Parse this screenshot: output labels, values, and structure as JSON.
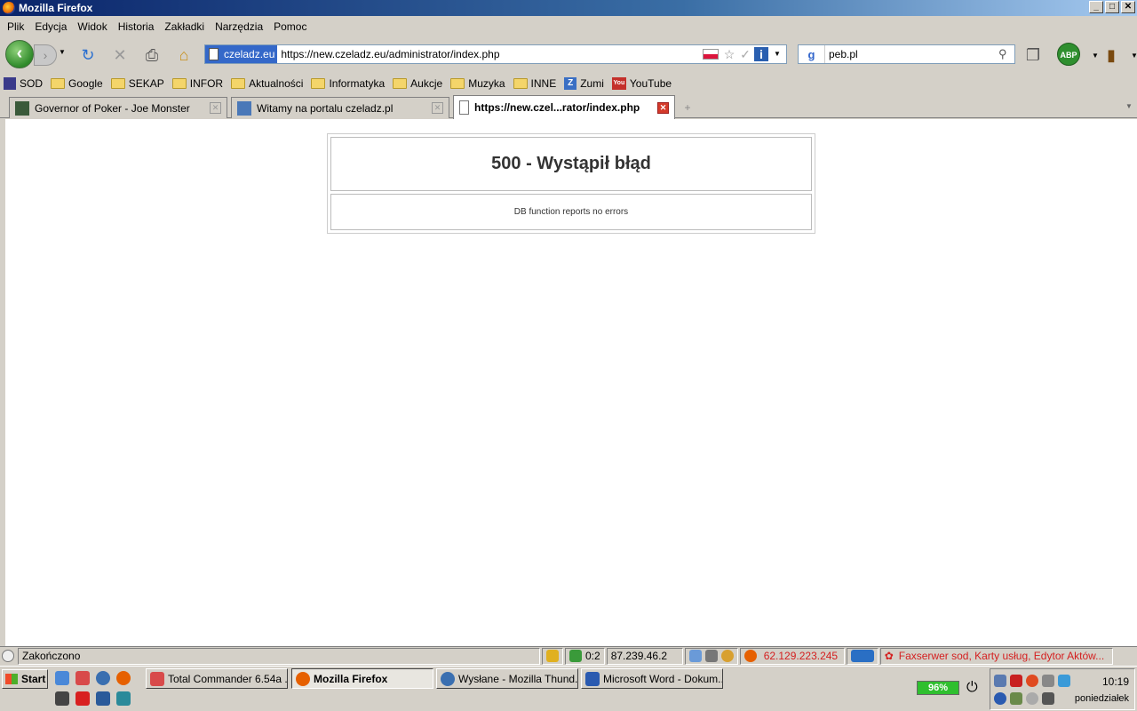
{
  "window": {
    "title": "Mozilla Firefox",
    "min": "_",
    "max": "□",
    "close": "✕"
  },
  "menu": [
    "Plik",
    "Edycja",
    "Widok",
    "Historia",
    "Zakładki",
    "Narzędzia",
    "Pomoc"
  ],
  "nav": {
    "site_identity": "czeladz.eu",
    "url": "https://new.czeladz.eu/administrator/index.php",
    "search_value": "peb.pl",
    "abp_label": "ABP"
  },
  "bookmarks": [
    {
      "label": "SOD",
      "icon": "sod-icon"
    },
    {
      "label": "Google",
      "icon": "folder-icon"
    },
    {
      "label": "SEKAP",
      "icon": "folder-icon"
    },
    {
      "label": "INFOR",
      "icon": "folder-icon"
    },
    {
      "label": "Aktualności",
      "icon": "folder-icon"
    },
    {
      "label": "Informatyka",
      "icon": "folder-icon"
    },
    {
      "label": "Aukcje",
      "icon": "folder-icon"
    },
    {
      "label": "Muzyka",
      "icon": "folder-icon"
    },
    {
      "label": "INNE",
      "icon": "folder-icon"
    },
    {
      "label": "Zumi",
      "icon": "zumi-icon"
    },
    {
      "label": "YouTube",
      "icon": "youtube-icon"
    }
  ],
  "tabs": [
    {
      "label": "Governor of Poker - Joe Monster"
    },
    {
      "label": "Witamy na portalu czeladz.pl"
    },
    {
      "label": "https://new.czel...rator/index.php"
    }
  ],
  "page": {
    "error_title": "500 - Wystąpił błąd",
    "error_message": "DB function reports no errors"
  },
  "status": {
    "text": "Zakończono",
    "counter": "0:2",
    "ip1": "87.239.46.2",
    "ip2": "62.129.223.245",
    "ticker": "Faxserwer sod, Karty usług, Edytor Aktów..."
  },
  "taskbar": {
    "start": "Start",
    "tasks": [
      "Total Commander 6.54a ...",
      "Mozilla Firefox",
      "Wysłane - Mozilla Thund...",
      "Microsoft Word - Dokum..."
    ],
    "battery": "96%",
    "clock": "10:19",
    "day": "poniedziałek"
  },
  "colors": {
    "accent": "#0a246a",
    "ip_highlight": "#d42020",
    "ticker": "#d42020"
  }
}
